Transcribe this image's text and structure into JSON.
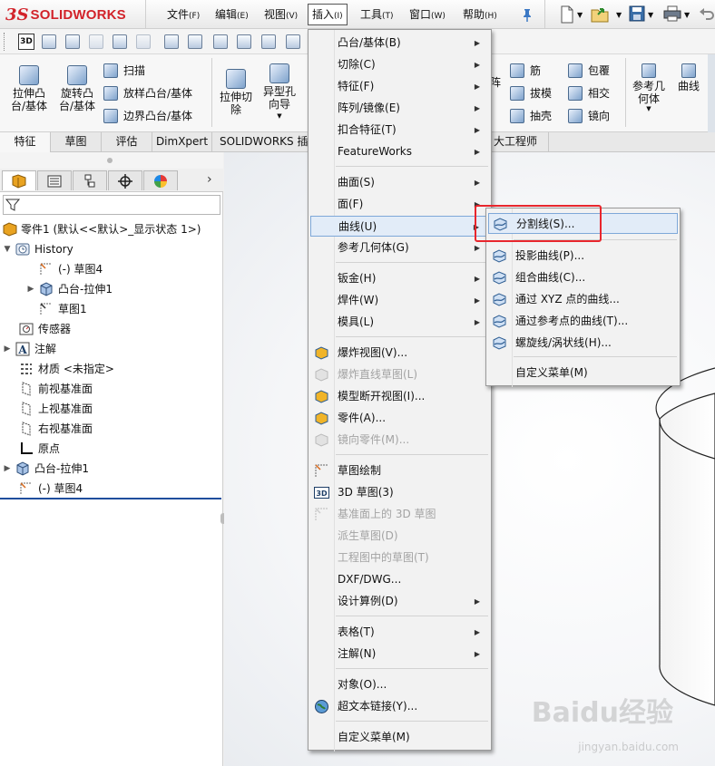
{
  "app": {
    "logo_ds": "3S",
    "logo_text": "SOLIDWORKS"
  },
  "menubar": [
    {
      "label": "文件",
      "acc": "(F)"
    },
    {
      "label": "编辑",
      "acc": "(E)"
    },
    {
      "label": "视图",
      "acc": "(V)"
    },
    {
      "label": "插入",
      "acc": "(I)"
    },
    {
      "label": "工具",
      "acc": "(T)"
    },
    {
      "label": "窗口",
      "acc": "(W)"
    },
    {
      "label": "帮助",
      "acc": "(H)"
    }
  ],
  "ribbon": {
    "extrude_boss": "拉伸凸台/基体",
    "revolve_boss": "旋转凸台/基体",
    "sweep": "扫描",
    "loft_boss": "放样凸台/基体",
    "boundary_boss": "边界凸台/基体",
    "extrude_cut": "拉伸切除",
    "hole_wizard": "异型孔向导",
    "pattern_partial": "阵",
    "rib": "筋",
    "wrap": "包覆",
    "draft": "拔模",
    "intersect": "相交",
    "shell": "抽壳",
    "mirror": "镜向",
    "ref_geometry": "参考几何体",
    "curves": "曲线"
  },
  "tabs": [
    {
      "label": "特征"
    },
    {
      "label": "草图"
    },
    {
      "label": "评估"
    },
    {
      "label": "DimXpert"
    },
    {
      "label": "SOLIDWORKS 插件"
    },
    {
      "label": "大工程师"
    }
  ],
  "tree": {
    "part": "零件1 (默认<<默认>_显示状态 1>)",
    "history": "History",
    "history_items": [
      "(-) 草图4",
      "凸台-拉伸1",
      "草图1"
    ],
    "sensors": "传感器",
    "annotations": "注解",
    "material": "材质 <未指定>",
    "front_plane": "前视基准面",
    "top_plane": "上视基准面",
    "right_plane": "右视基准面",
    "origin": "原点",
    "boss_extrude": "凸台-拉伸1",
    "sketch4": "(-) 草图4"
  },
  "insert_menu": [
    {
      "label": "凸台/基体(B)",
      "sub": true
    },
    {
      "label": "切除(C)",
      "sub": true
    },
    {
      "label": "特征(F)",
      "sub": true
    },
    {
      "label": "阵列/镜像(E)",
      "sub": true
    },
    {
      "label": "扣合特征(T)",
      "sub": true
    },
    {
      "label": "FeatureWorks",
      "sub": true
    },
    {
      "label": "曲面(S)",
      "sub": true
    },
    {
      "label": "面(F)",
      "sub": true
    },
    {
      "label": "曲线(U)",
      "sub": true
    },
    {
      "label": "参考几何体(G)",
      "sub": true
    },
    {
      "label": "钣金(H)",
      "sub": true
    },
    {
      "label": "焊件(W)",
      "sub": true
    },
    {
      "label": "模具(L)",
      "sub": true
    },
    {
      "label": "爆炸视图(V)..."
    },
    {
      "label": "爆炸直线草图(L)"
    },
    {
      "label": "模型断开视图(I)..."
    },
    {
      "label": "零件(A)..."
    },
    {
      "label": "镜向零件(M)..."
    },
    {
      "label": "草图绘制"
    },
    {
      "label": "3D 草图(3)"
    },
    {
      "label": "基准面上的 3D 草图"
    },
    {
      "label": "派生草图(D)"
    },
    {
      "label": "工程图中的草图(T)"
    },
    {
      "label": "DXF/DWG..."
    },
    {
      "label": "设计算例(D)",
      "sub": true
    },
    {
      "label": "表格(T)",
      "sub": true
    },
    {
      "label": "注解(N)",
      "sub": true
    },
    {
      "label": "对象(O)..."
    },
    {
      "label": "超文本链接(Y)..."
    },
    {
      "label": "自定义菜单(M)"
    }
  ],
  "curves_menu": [
    {
      "label": "分割线(S)..."
    },
    {
      "label": "投影曲线(P)..."
    },
    {
      "label": "组合曲线(C)..."
    },
    {
      "label": "通过 XYZ 点的曲线..."
    },
    {
      "label": "通过参考点的曲线(T)..."
    },
    {
      "label": "螺旋线/涡状线(H)..."
    },
    {
      "label": "自定义菜单(M)"
    }
  ],
  "watermark": {
    "main": "Baidu经验",
    "sub": "jingyan.baidu.com"
  },
  "colors": {
    "accent_red": "#e8262d",
    "brand_red": "#d2232a",
    "selection_blue": "#1f4e9d"
  }
}
